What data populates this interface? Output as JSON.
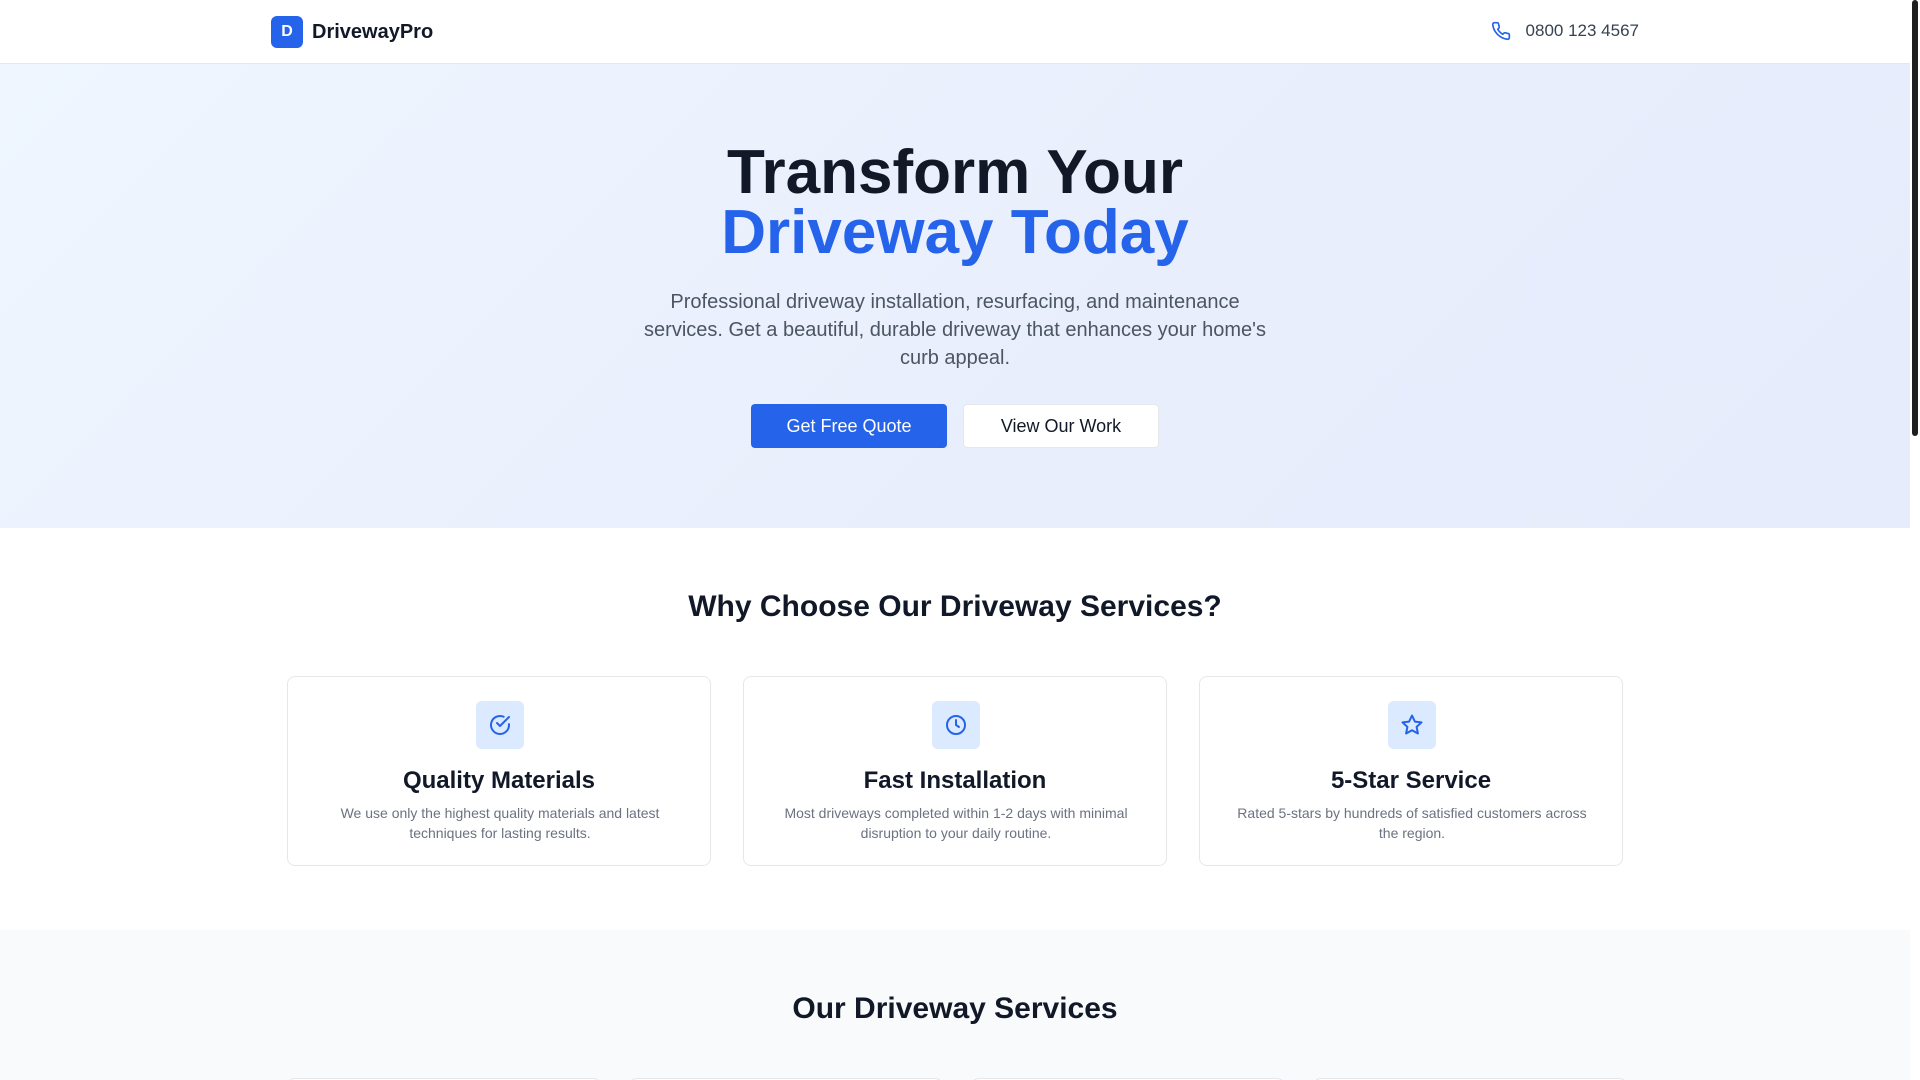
{
  "header": {
    "logo_letter": "D",
    "brand": "DrivewayPro",
    "phone": "0800 123 4567"
  },
  "hero": {
    "title_line1": "Transform Your",
    "title_line2": "Driveway Today",
    "description": "Professional driveway installation, resurfacing, and maintenance services. Get a beautiful, durable driveway that enhances your home's curb appeal.",
    "primary_button": "Get Free Quote",
    "secondary_button": "View Our Work"
  },
  "why": {
    "title": "Why Choose Our Driveway Services?",
    "cards": [
      {
        "icon": "check-circle-icon",
        "title": "Quality Materials",
        "description": "We use only the highest quality materials and latest techniques for lasting results."
      },
      {
        "icon": "clock-icon",
        "title": "Fast Installation",
        "description": "Most driveways completed within 1-2 days with minimal disruption to your daily routine."
      },
      {
        "icon": "star-icon",
        "title": "5-Star Service",
        "description": "Rated 5-stars by hundreds of satisfied customers across the region."
      }
    ]
  },
  "services": {
    "title": "Our Driveway Services"
  },
  "colors": {
    "accent": "#2563eb",
    "icon_bg": "#dbeafe",
    "hero_bg": "#eff6ff"
  }
}
